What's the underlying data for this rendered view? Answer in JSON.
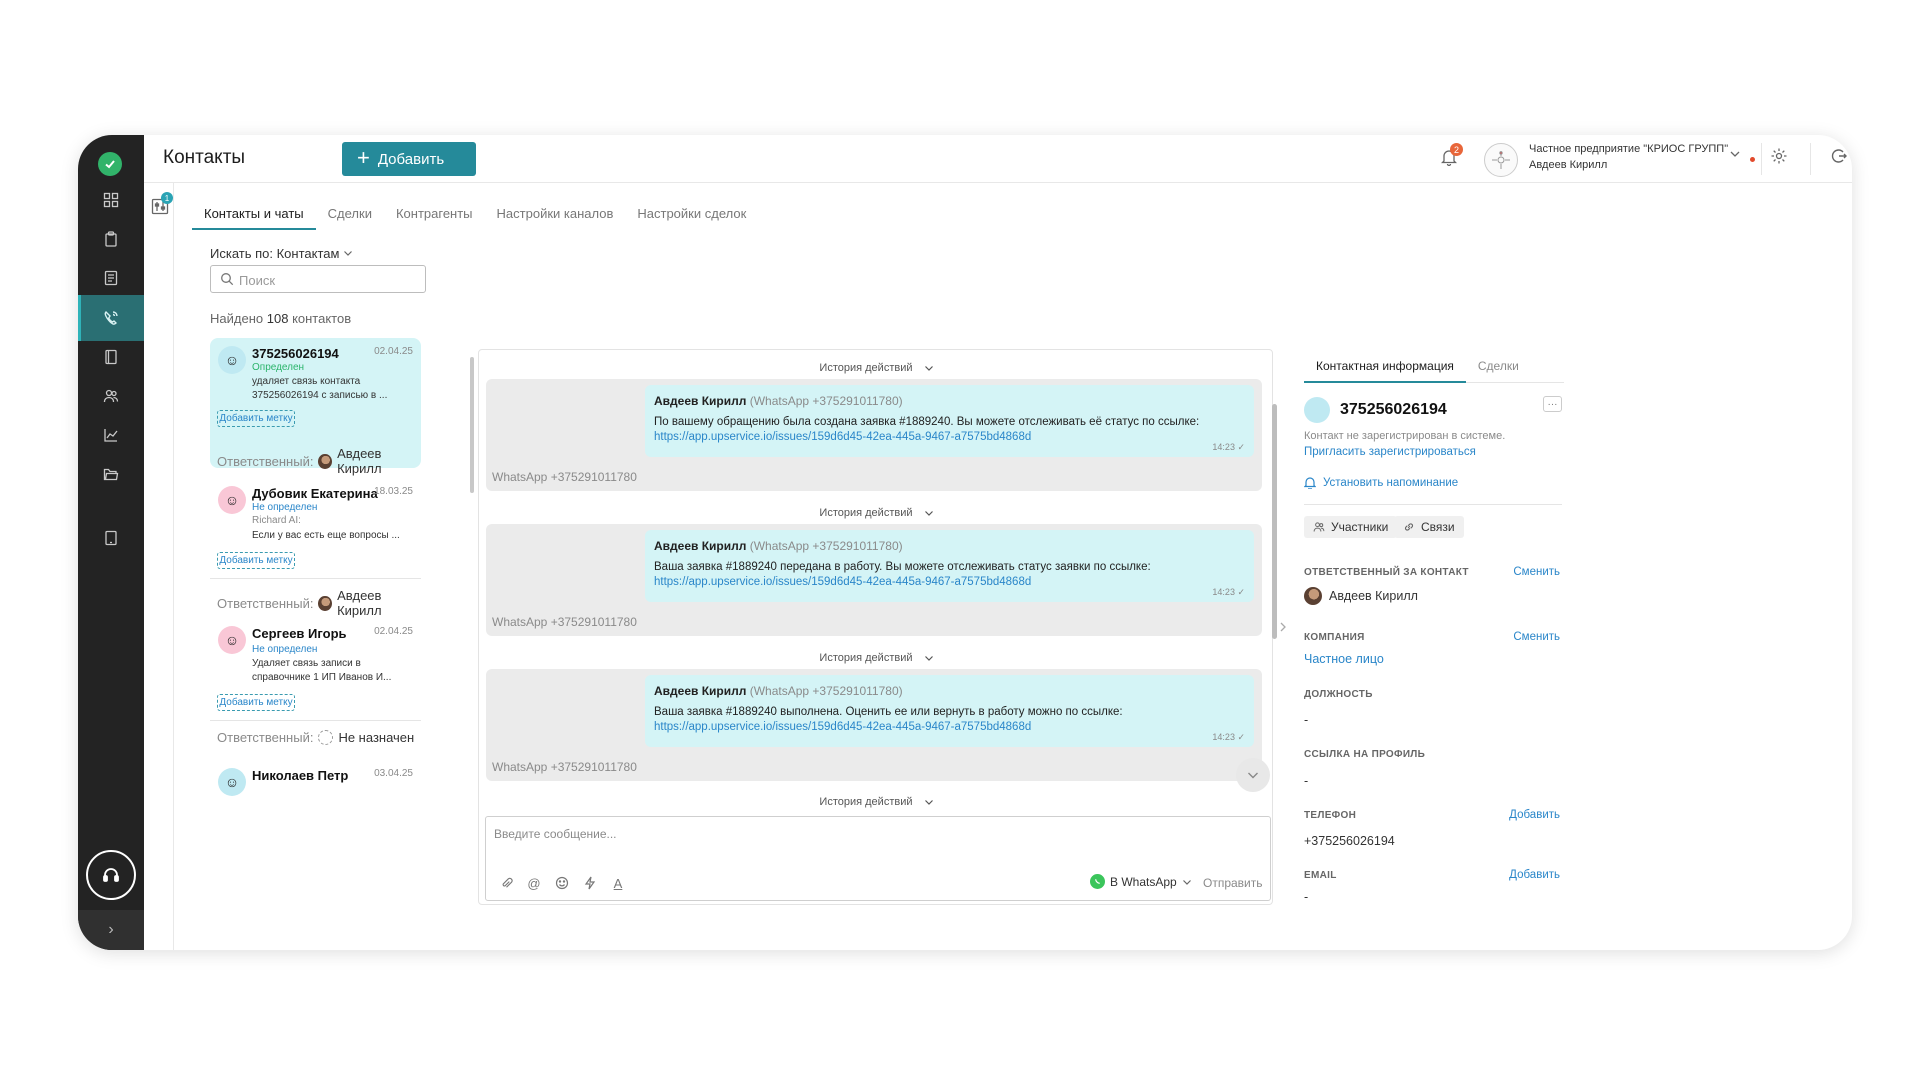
{
  "header": {
    "title": "Контакты",
    "add_button": "Добавить",
    "notifications_count": "2",
    "company_name": "Частное предприятие \"КРИОС ГРУПП\"",
    "user_name": "Авдеев Кирилл"
  },
  "filter_badge": "1",
  "tabs": [
    {
      "label": "Контакты и чаты",
      "active": true
    },
    {
      "label": "Сделки"
    },
    {
      "label": "Контрагенты"
    },
    {
      "label": "Настройки каналов"
    },
    {
      "label": "Настройки сделок"
    }
  ],
  "search": {
    "by_label": "Искать по: Контактам",
    "placeholder": "Поиск",
    "found_prefix": "Найдено",
    "found_count": "108",
    "found_suffix": "контактов"
  },
  "contacts": [
    {
      "name": "375256026194",
      "date": "02.04.25",
      "status": "Определен",
      "status_color": "#2bb46b",
      "line1": "удаляет связь контакта",
      "line2": "375256026194 с записью в ...",
      "tag": "Добавить метку",
      "responsible_label": "Ответственный:",
      "responsible": "Авдеев Кирилл"
    },
    {
      "name": "Дубовик Екатерина",
      "date": "18.03.25",
      "status": "Не определен",
      "status_color": "#2a86c9",
      "author": "Richard AI:",
      "line2": "Если у вас есть еще вопросы ...",
      "tag": "Добавить метку",
      "responsible_label": "Ответственный:",
      "responsible": "Авдеев Кирилл"
    },
    {
      "name": "Сергеев Игорь",
      "date": "02.04.25",
      "status": "Не определен",
      "status_color": "#2a86c9",
      "line1": "Удаляет связь записи в",
      "line2": "справочнике 1 ИП Иванов И...",
      "tag": "Добавить метку",
      "responsible_label": "Ответственный:",
      "responsible": "Не назначен"
    },
    {
      "name": "Николаев Петр",
      "date": "03.04.25"
    }
  ],
  "chat": {
    "history_label": "История действий",
    "messages": [
      {
        "sender": "Авдеев Кирилл",
        "channel": "(WhatsApp +375291011780)",
        "text": "По вашему обращению была создана заявка #1889240. Вы можете отслеживать её статус по ссылке:",
        "link": "https://app.upservice.io/issues/159d6d45-42ea-445a-9467-a7575bd4868d",
        "time": "14:23",
        "footer": "WhatsApp +375291011780"
      },
      {
        "sender": "Авдеев Кирилл",
        "channel": "(WhatsApp +375291011780)",
        "text": "Ваша заявка #1889240 передана в работу. Вы можете отслеживать статус заявки по ссылке:",
        "link": "https://app.upservice.io/issues/159d6d45-42ea-445a-9467-a7575bd4868d",
        "time": "14:23",
        "footer": "WhatsApp +375291011780"
      },
      {
        "sender": "Авдеев Кирилл",
        "channel": "(WhatsApp +375291011780)",
        "text": "Ваша заявка #1889240 выполнена. Оценить ее или вернуть в работу можно по ссылке:",
        "link": "https://app.upservice.io/issues/159d6d45-42ea-445a-9467-a7575bd4868d",
        "time": "14:23",
        "footer": "WhatsApp +375291011780"
      }
    ],
    "composer_placeholder": "Введите сообщение...",
    "channel_select": "В WhatsApp",
    "send_label": "Отправить"
  },
  "info": {
    "tabs": [
      {
        "label": "Контактная информация",
        "active": true
      },
      {
        "label": "Сделки"
      }
    ],
    "phone_title": "375256026194",
    "not_registered": "Контакт не зарегистрирован в системе.",
    "invite": "Пригласить зарегистрироваться",
    "reminder": "Установить напоминание",
    "participants": "Участники",
    "links": "Связи",
    "responsible_label": "ОТВЕТСТВЕННЫЙ ЗА КОНТАКТ",
    "change": "Сменить",
    "responsible_value": "Авдеев Кирилл",
    "company_label": "КОМПАНИЯ",
    "company_value": "Частное лицо",
    "position_label": "ДОЛЖНОСТЬ",
    "position_value": "-",
    "profile_label": "ССЫЛКА НА ПРОФИЛЬ",
    "profile_value": "-",
    "phone_label": "ТЕЛЕФОН",
    "add": "Добавить",
    "phone_value": "+375256026194",
    "email_label": "EMAIL",
    "email_value": "-"
  },
  "colors": {
    "accent": "#258a9a",
    "sidebar": "#232323",
    "bubble": "#d4f4f6",
    "link": "#2a86c9"
  }
}
